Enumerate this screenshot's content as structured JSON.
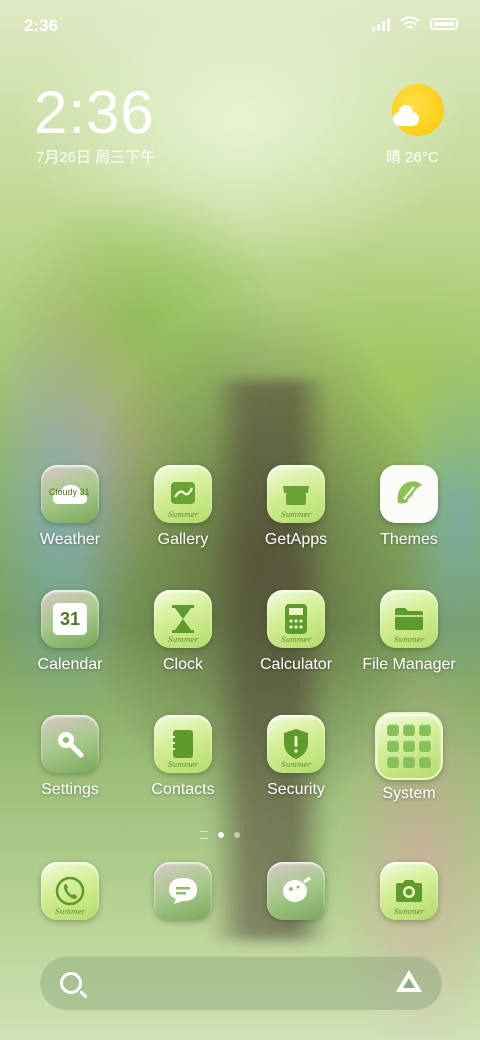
{
  "status_bar": {
    "time": "2:36"
  },
  "clock_widget": {
    "time": "2:36",
    "date": "7月26日 周三下午"
  },
  "weather_widget": {
    "text": "晴 26°C"
  },
  "apps": [
    {
      "label": "Weather",
      "badge": "Cloudy 31",
      "icon": "weather-icon"
    },
    {
      "label": "Gallery",
      "tag": "Summer",
      "icon": "gallery-icon"
    },
    {
      "label": "GetApps",
      "tag": "Summer",
      "icon": "store-icon"
    },
    {
      "label": "Themes",
      "icon": "themes-icon"
    },
    {
      "label": "Calendar",
      "day": "31",
      "icon": "calendar-icon"
    },
    {
      "label": "Clock",
      "tag": "Summer",
      "icon": "hourglass-icon"
    },
    {
      "label": "Calculator",
      "tag": "Summer",
      "icon": "calculator-icon"
    },
    {
      "label": "File Manager",
      "tag": "Summer",
      "icon": "folder-icon"
    },
    {
      "label": "Settings",
      "icon": "wrench-icon"
    },
    {
      "label": "Contacts",
      "tag": "Summer",
      "icon": "contacts-icon"
    },
    {
      "label": "Security",
      "tag": "Summer",
      "icon": "shield-icon"
    },
    {
      "label": "System",
      "icon": "folder-grid-icon"
    }
  ],
  "dock": [
    {
      "icon": "phone-icon",
      "tag": "Summer"
    },
    {
      "icon": "message-icon"
    },
    {
      "icon": "browser-icon"
    },
    {
      "icon": "camera-icon",
      "tag": "Summer"
    }
  ],
  "page_indicator": {
    "pages": 2,
    "active": 1
  }
}
